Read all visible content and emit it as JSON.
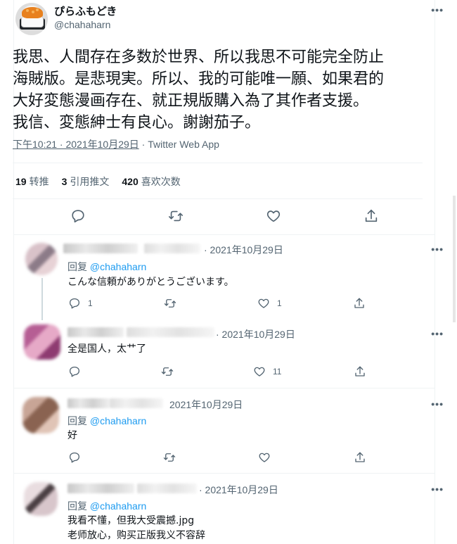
{
  "tweet": {
    "display_name": "ぴらふもどき",
    "handle": "@chahaharn",
    "text_lines": [
      "我思、人間存在多数於世界、所以我思不可能完全防止",
      "海賊版。是悲現実。所以、我的可能唯一願、如果君的",
      "大好変態漫画存在、就正規版購入為了其作者支援。",
      "我信、変態紳士有良心。謝謝茄子。"
    ],
    "time": "下午10:21 · 2021年10月29日",
    "separator": " · ",
    "source": "Twitter Web App",
    "stats": {
      "retweets_count": "19",
      "retweets_label": "转推",
      "quotes_count": "3",
      "quotes_label": "引用推文",
      "likes_count": "420",
      "likes_label": "喜欢次数"
    },
    "more_label": "•••"
  },
  "replies": [
    {
      "date": "· 2021年10月29日",
      "reply_to_label": "回复 ",
      "reply_to_handle": "@chahaharn",
      "text_lines": [
        "こんな信頼がありがとうございます。"
      ],
      "reply_count": "1",
      "like_count": "1"
    },
    {
      "date": "· 2021年10月29日",
      "text_lines": [
        "全是国人，太艹了"
      ],
      "reply_count": "",
      "like_count": "11"
    },
    {
      "date": "2021年10月29日",
      "reply_to_label": "回复 ",
      "reply_to_handle": "@chahaharn",
      "text_lines": [
        "好"
      ],
      "reply_count": "",
      "like_count": ""
    },
    {
      "date": "· 2021年10月29日",
      "reply_to_label": "回复 ",
      "reply_to_handle": "@chahaharn",
      "text_lines": [
        "我看不懂，但我大受震撼.jpg",
        "老师放心，购买正版我义不容辞"
      ],
      "reply_count": "",
      "like_count": ""
    }
  ],
  "icons": {
    "reply": "reply-icon",
    "retweet": "retweet-icon",
    "like": "heart-icon",
    "share": "share-icon",
    "more": "more-icon"
  },
  "colors": {
    "link": "#1d9bf0",
    "secondary": "#536471",
    "text": "#0f1419"
  }
}
